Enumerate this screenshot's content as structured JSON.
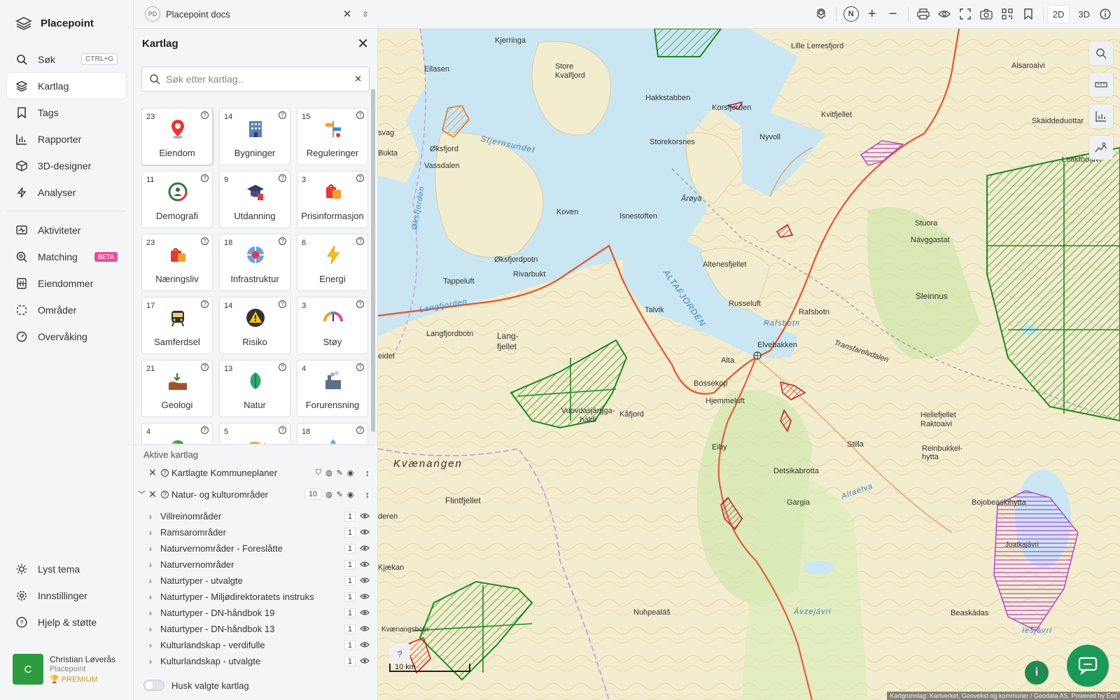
{
  "app": {
    "name": "Placepoint"
  },
  "nav": {
    "items": [
      {
        "label": "Søk",
        "shortcut": "CTRL+G"
      },
      {
        "label": "Kartlag"
      },
      {
        "label": "Tags"
      },
      {
        "label": "Rapporter"
      },
      {
        "label": "3D-designer"
      },
      {
        "label": "Analyser"
      },
      {
        "label": "Aktiviteter"
      },
      {
        "label": "Matching",
        "badge": "BETA"
      },
      {
        "label": "Eiendommer"
      },
      {
        "label": "Områder"
      },
      {
        "label": "Overvåking"
      }
    ],
    "bottom": [
      {
        "label": "Lyst tema"
      },
      {
        "label": "Innstillinger"
      },
      {
        "label": "Hjelp & støtte"
      }
    ],
    "user": {
      "initial": "C",
      "name": "Christian Løverås",
      "org": "Placepoint",
      "plan": "PREMIUM"
    }
  },
  "topbar": {
    "workspace_badge": "PD",
    "workspace_name": "Placepoint docs",
    "compass": "N",
    "mode_2d": "2D",
    "mode_3d": "3D"
  },
  "panel": {
    "title": "Kartlag",
    "search_placeholder": "Søk etter kartlag..",
    "tiles": [
      {
        "count": "23",
        "name": "Eiendom"
      },
      {
        "count": "14",
        "name": "Bygninger"
      },
      {
        "count": "15",
        "name": "Reguleringer"
      },
      {
        "count": "11",
        "name": "Demografi"
      },
      {
        "count": "9",
        "name": "Utdanning"
      },
      {
        "count": "3",
        "name": "Prisinformasjon"
      },
      {
        "count": "23",
        "name": "Næringsliv"
      },
      {
        "count": "18",
        "name": "Infrastruktur"
      },
      {
        "count": "6",
        "name": "Energi"
      },
      {
        "count": "17",
        "name": "Samferdsel"
      },
      {
        "count": "14",
        "name": "Risiko"
      },
      {
        "count": "3",
        "name": "Støy"
      },
      {
        "count": "21",
        "name": "Geologi"
      },
      {
        "count": "13",
        "name": "Natur"
      },
      {
        "count": "4",
        "name": "Forurensning"
      },
      {
        "count": "4",
        "name": ""
      },
      {
        "count": "5",
        "name": ""
      },
      {
        "count": "18",
        "name": ""
      }
    ],
    "active_title": "Aktive kartlag",
    "groups": [
      {
        "name": "Kartlagte Kommuneplaner"
      },
      {
        "name": "Natur- og kulturområder",
        "count": "10"
      }
    ],
    "sublayers": [
      {
        "name": "Villreinområder",
        "n": "1"
      },
      {
        "name": "Ramsarområder",
        "n": "1"
      },
      {
        "name": "Naturvernområder - Foreslåtte",
        "n": "1"
      },
      {
        "name": "Naturvernområder",
        "n": "1"
      },
      {
        "name": "Naturtyper - utvalgte",
        "n": "1"
      },
      {
        "name": "Naturtyper - Miljødirektoratets instruks",
        "n": "1"
      },
      {
        "name": "Naturtyper - DN-håndbok 19",
        "n": "1"
      },
      {
        "name": "Naturtyper - DN-håndbok 13",
        "n": "1"
      },
      {
        "name": "Kulturlandskap - verdifulle",
        "n": "1"
      },
      {
        "name": "Kulturlandskap - utvalgte",
        "n": "1"
      }
    ],
    "remember_label": "Husk valgte kartlag"
  },
  "map": {
    "labels": {
      "kjerringa": "Kjerringa",
      "ellasen": "Ellasen",
      "store_kvalfjord": "Store Kvalfjord",
      "hakkstabben": "Hakkstabben",
      "lille_lerresfjord": "Lille Lerresfjord",
      "alsaroaivi": "Alsaroaivi",
      "korsfjorden": "Korsfjorden",
      "nyvoll": "Nyvoll",
      "kvitfjellet": "Kvitfjellet",
      "skaiddeduottar": "Skáiddeduottar",
      "oksfjord": "Øksfjord",
      "vassdalen": "Vassdalen",
      "stjernsundet": "Stjernsundet",
      "storekorsnes": "Storekorsnes",
      "aroya": "Årøya",
      "leaktooaivi": "Leaktooaivi",
      "koven": "Koven",
      "isnestoften": "Isnestoften",
      "stuora": "Stuora",
      "navggastat": "Návggastat",
      "oksfjordpotn": "Øksfjordpotn",
      "rivarbukt": "Rivarbukt",
      "altenesfjellet": "Altenesfjellet",
      "tappeluft": "Tappeluft",
      "altafjorden": "ALTAFJORDEN",
      "russeluft": "Russeluft",
      "rafsbotn": "Rafsbotn",
      "sleinnus": "Sleinnus",
      "langfjorden": "Langfjorden",
      "talvik": "Talvik",
      "rafsbotn_w": "Rafsbotn",
      "langfjordbotn": "Langfjordbotn",
      "lang_fjellet": "Lang-fjellet",
      "elvebakken": "Elvebakken",
      "alta": "Alta",
      "transfarelvdalen": "Transfarelvdalen",
      "bossekop": "Bossekop",
      "hjemmeluft": "Hjemmeluft",
      "kafjord": "Kåfjord",
      "vuovdasjargga": "Vuovdasjárgga-háldi",
      "hellefjellet": "Hellefjellet Raktoaivi",
      "kvaenangen": "Kvænangen",
      "eiby": "Eiby",
      "stilla": "Stilla",
      "reinbukkel": "Reinbukkel-hytta",
      "detsikabrotta": "Detsikabrotta",
      "altaelva": "Altaelva",
      "flintfjellet": "Flintfjellet",
      "gargia": "Gargia",
      "bojobeaskihytta": "Bojobeaskihytta",
      "joatkajavri": "Joatkajávri",
      "kjaekan": "Kjækan",
      "beaskadas": "Beaskádas",
      "nuhpealas": "Nuhpealáš",
      "avzejavri": "Ávzejávri",
      "kvaenangsbotn": "Kvænangsbotn",
      "iesjavri": "Iešjávri",
      "eidet": "eidet",
      "deren": "deren",
      "oksfjorden": "Øksfjorden",
      "svag": "svag",
      "bukta": "Bukta"
    },
    "scale": "10 km",
    "attribution": "Kartgrunnlag: Kartverket, Geovekst og kommuner / Geodata AS, Powered by Esri"
  },
  "colors": {
    "accent_green": "#1f8c4d",
    "beta_pink": "#e84d9a",
    "premium": "#d99a10"
  }
}
